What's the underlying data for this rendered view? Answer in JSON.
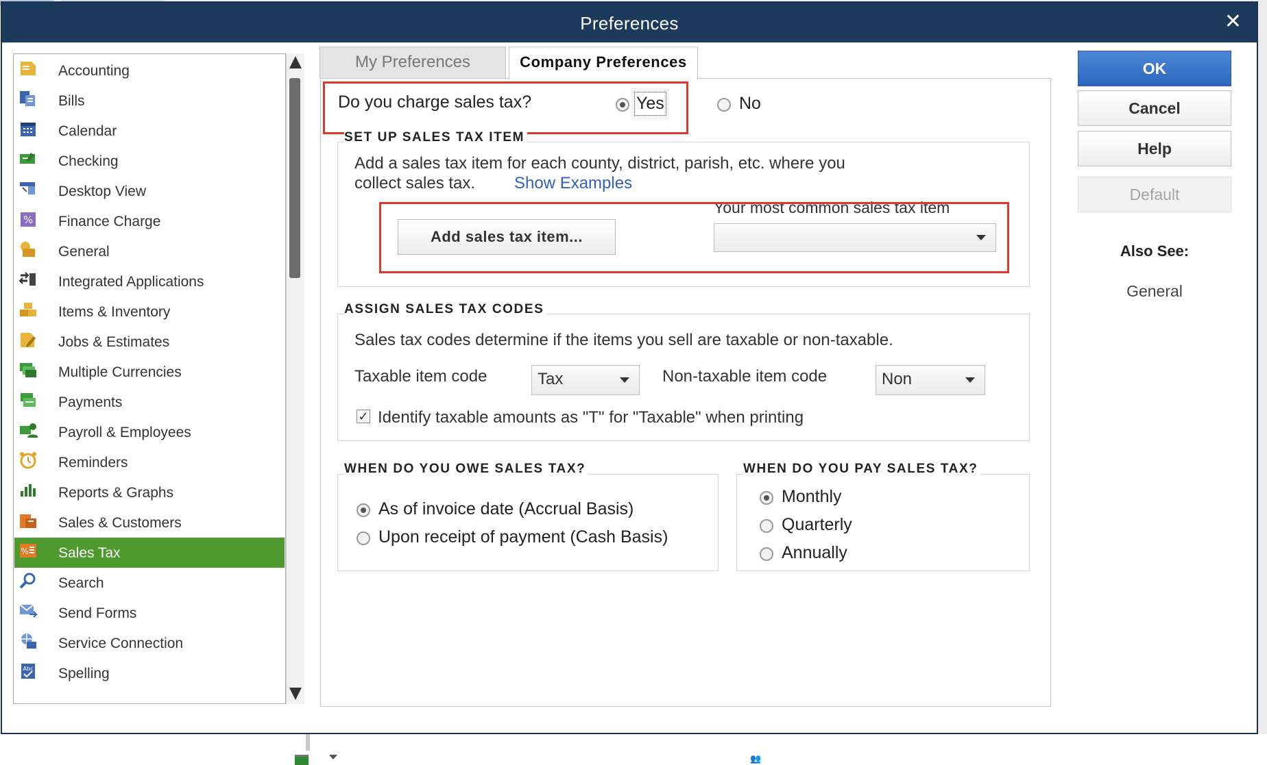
{
  "window": {
    "title": "Preferences",
    "close_glyph": "✕"
  },
  "sidebar": {
    "items": [
      {
        "label": "Accounting",
        "icon": "accounting-icon",
        "color": "#e0a624"
      },
      {
        "label": "Bills",
        "icon": "bills-icon",
        "color": "#3a66b0"
      },
      {
        "label": "Calendar",
        "icon": "calendar-icon",
        "color": "#3a66b0"
      },
      {
        "label": "Checking",
        "icon": "checking-icon",
        "color": "#3c9a3a"
      },
      {
        "label": "Desktop View",
        "icon": "desktop-view-icon",
        "color": "#3a66b0"
      },
      {
        "label": "Finance Charge",
        "icon": "finance-charge-icon",
        "color": "#7a5aa8"
      },
      {
        "label": "General",
        "icon": "general-icon",
        "color": "#e0a624"
      },
      {
        "label": "Integrated Applications",
        "icon": "integrated-applications-icon",
        "color": "#3a3a3a"
      },
      {
        "label": "Items & Inventory",
        "icon": "items-inventory-icon",
        "color": "#e0a624"
      },
      {
        "label": "Jobs & Estimates",
        "icon": "jobs-estimates-icon",
        "color": "#e0a624"
      },
      {
        "label": "Multiple Currencies",
        "icon": "multiple-currencies-icon",
        "color": "#3c9a3a"
      },
      {
        "label": "Payments",
        "icon": "payments-icon",
        "color": "#3c9a3a"
      },
      {
        "label": "Payroll & Employees",
        "icon": "payroll-employees-icon",
        "color": "#3c9a3a"
      },
      {
        "label": "Reminders",
        "icon": "reminders-icon",
        "color": "#e0a624"
      },
      {
        "label": "Reports & Graphs",
        "icon": "reports-graphs-icon",
        "color": "#3c9a3a"
      },
      {
        "label": "Sales & Customers",
        "icon": "sales-customers-icon",
        "color": "#e07a24"
      },
      {
        "label": "Sales Tax",
        "icon": "sales-tax-icon",
        "color": "#e07a24",
        "selected": true
      },
      {
        "label": "Search",
        "icon": "search-icon",
        "color": "#3a66b0"
      },
      {
        "label": "Send Forms",
        "icon": "send-forms-icon",
        "color": "#3a66b0"
      },
      {
        "label": "Service Connection",
        "icon": "service-connection-icon",
        "color": "#3a66b0"
      },
      {
        "label": "Spelling",
        "icon": "spelling-icon",
        "color": "#3a66b0"
      }
    ]
  },
  "tabs": {
    "my_preferences": "My Preferences",
    "company_preferences": "Company Preferences"
  },
  "sales_tax_question": {
    "label": "Do you charge sales tax?",
    "yes": "Yes",
    "no": "No",
    "selected": "Yes"
  },
  "setup_item": {
    "heading": "SET UP SALES TAX ITEM",
    "line1": "Add a sales tax item for each county, district, parish, etc. where you",
    "line2": "collect sales tax.",
    "show_examples": "Show Examples",
    "add_button": "Add sales tax item...",
    "most_common_label": "Your most common sales tax item",
    "most_common_value": ""
  },
  "assign_codes": {
    "heading": "ASSIGN SALES TAX CODES",
    "description": "Sales tax codes determine if the items you sell are taxable or non-taxable.",
    "taxable_label": "Taxable item code",
    "taxable_value": "Tax",
    "nontaxable_label": "Non-taxable item code",
    "nontaxable_value": "Non",
    "identify_label": "Identify taxable amounts as \"T\" for \"Taxable\" when printing",
    "identify_checked": true
  },
  "owe": {
    "heading": "WHEN DO YOU OWE SALES TAX?",
    "accrual": "As of invoice date (Accrual Basis)",
    "cash": "Upon receipt of payment (Cash Basis)",
    "selected": "accrual"
  },
  "pay": {
    "heading": "WHEN DO YOU PAY SALES TAX?",
    "monthly": "Monthly",
    "quarterly": "Quarterly",
    "annually": "Annually",
    "selected": "monthly"
  },
  "buttons": {
    "ok": "OK",
    "cancel": "Cancel",
    "help": "Help",
    "default": "Default"
  },
  "also_see": {
    "title": "Also See:",
    "items": [
      "General"
    ]
  },
  "colors": {
    "titlebar": "#1d3a5c",
    "selected_row": "#4e9a2e",
    "ok_button": "#3a73c9",
    "link": "#2f62b7",
    "highlight_box": "#e2382b"
  }
}
